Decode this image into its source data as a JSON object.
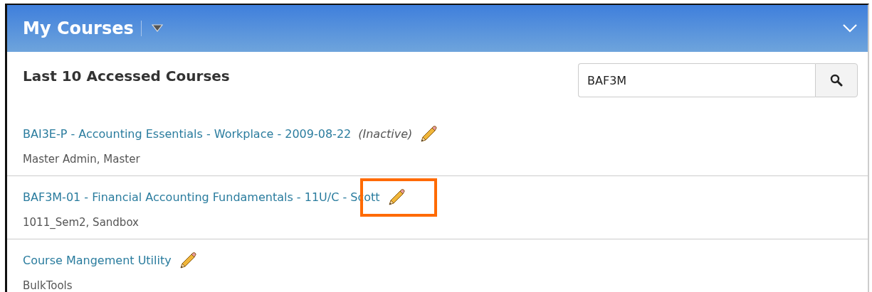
{
  "panel": {
    "title": "My Courses",
    "heading": "Last 10 Accessed Courses"
  },
  "search": {
    "value": "BAF3M"
  },
  "courses": [
    {
      "name": "BAI3E-P - Accounting Essentials - Workplace - 2009-08-22",
      "status": "(Inactive)",
      "details": "Master Admin, Master",
      "highlighted": false
    },
    {
      "name": "BAF3M-01 - Financial Accounting Fundamentals - 11U/C - Scott",
      "details": "1011_Sem2, Sandbox",
      "highlighted": true
    },
    {
      "name": "Course Mangement Utility",
      "details": "BulkTools",
      "highlighted": false
    }
  ]
}
